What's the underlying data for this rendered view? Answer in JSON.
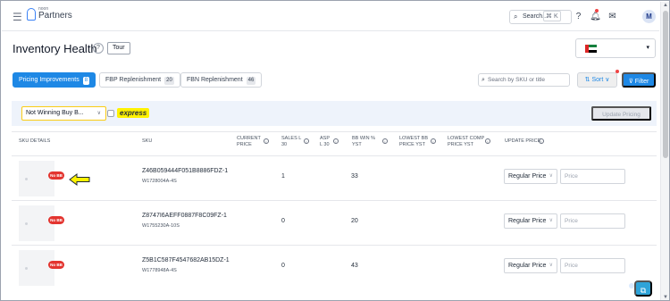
{
  "app": {
    "logo_small": "noon",
    "logo_big": "Partners",
    "search_label": "Search...",
    "search_shortcut": "⌘ K",
    "avatar_initial": "M"
  },
  "page": {
    "title": "Inventory Health",
    "tour_label": "Tour",
    "country_caret": "▾"
  },
  "tabs": [
    {
      "label": "Pricing Improvements",
      "count": "8",
      "active": true
    },
    {
      "label": "FBP Replenishment",
      "count": "20",
      "active": false
    },
    {
      "label": "FBN Replenishment",
      "count": "46",
      "active": false
    }
  ],
  "toolbar": {
    "sku_search_placeholder": "Search by SKU or title",
    "sort_label": "⇅ Sort ∨",
    "filter_label": "⊽ Filter"
  },
  "filters": {
    "dropdown_value": "Not Winning Buy B...",
    "express_label": "express",
    "update_pricing_label": "Update Pricing"
  },
  "table": {
    "headers": {
      "sku_details": "SKU DETAILS",
      "sku": "SKU",
      "current_price_1": "CURRENT",
      "current_price_2": "PRICE",
      "sales_1": "SALES L",
      "sales_2": "30",
      "asp_1": "ASP",
      "asp_2": "L 30",
      "bb_win_1": "BB WIN %",
      "bb_win_2": "YST",
      "lowest_bb_1": "LOWEST BB",
      "lowest_bb_2": "PRICE YST",
      "lowest_comp_1": "LOWEST COMP",
      "lowest_comp_2": "PRICE YST",
      "update_price": "UPDATE PRICE"
    },
    "rows": [
      {
        "badge": "No BB",
        "sku": "Z46B059444F051B8886FDZ-1",
        "partner_sku": "W1728004A-4S",
        "sales": "1",
        "bb_win": "33",
        "price_type": "Regular Price",
        "price_placeholder": "Price"
      },
      {
        "badge": "No BB",
        "sku": "Z8747I6AEFF0887F8C09FZ-1",
        "partner_sku": "W1755230A-10S",
        "sales": "0",
        "bb_win": "20",
        "price_type": "Regular Price",
        "price_placeholder": "Price"
      },
      {
        "badge": "No BB",
        "sku": "Z5B1C587F4547682AB15DZ-1",
        "partner_sku": "W1778948A-4S",
        "sales": "0",
        "bb_win": "43",
        "price_type": "Regular Price",
        "price_placeholder": "Price"
      }
    ]
  },
  "colors": {
    "primary": "#1e88e5",
    "badge_red": "#e3342f",
    "highlight_yellow": "#fff200",
    "filterbar_bg": "#eef3fb"
  },
  "icons": [
    "hamburger-icon",
    "search-icon",
    "help-icon",
    "notification-icon",
    "mail-icon",
    "uae-flag-icon",
    "arrow-left-icon",
    "chat-icon",
    "info-icon"
  ]
}
